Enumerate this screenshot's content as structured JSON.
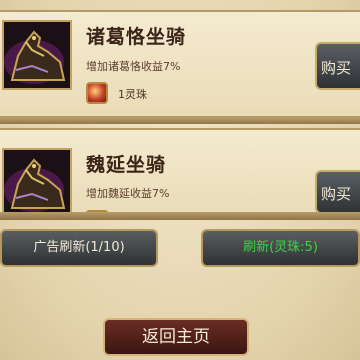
{
  "items": [
    {
      "title": "诸葛恪坐骑",
      "desc": "增加诸葛恪收益7%",
      "cost": "1灵珠",
      "buy_label": "购买"
    },
    {
      "title": "魏延坐骑",
      "desc": "增加魏延收益7%",
      "buy_label": "购买"
    }
  ],
  "buttons": {
    "ad_refresh": "广告刷新(1/10)",
    "refresh": "刷新(灵珠:5)",
    "return_home": "返回主页"
  },
  "colors": {
    "refresh_text": "#3fd14a",
    "ad_refresh_text": "#f2ead8",
    "portrait_glow": "#7d2a7a"
  },
  "icons": {
    "cost": "spirit-pearl-icon",
    "portrait": "horse-mount-icon"
  }
}
